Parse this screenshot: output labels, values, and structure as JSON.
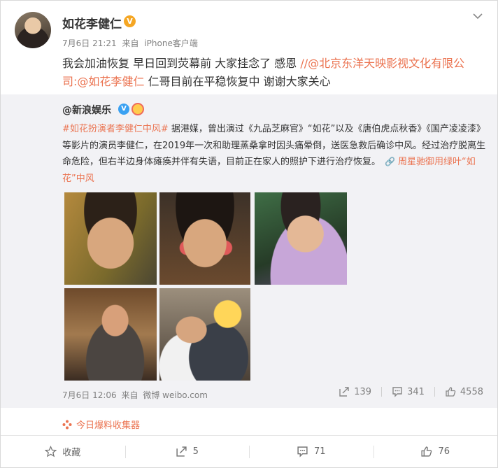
{
  "post": {
    "author": "如花李健仁",
    "verified_badge": "V",
    "date": "7月6日 21:21",
    "source_prefix": "来自",
    "source": "iPhone客户端",
    "text_main": "我会加油恢复 早日回到荧幕前 大家挂念了 感恩 ",
    "text_link1": "//@北京东洋天映影视文化有限公司",
    "text_colon": ":",
    "text_link2": "@如花李健仁",
    "text_tail": " 仁哥目前在平稳恢复中 谢谢大家关心"
  },
  "repost": {
    "author": "@新浪娱乐",
    "hashtag": "#如花扮演者李健仁中风#",
    "body": " 据港媒，曾出演过《九品芝麻官》“如花”以及《唐伯虎点秋香》《国产凌凌漆》等影片的演员李健仁，在2019年一次和助理蒸桑拿时因头痛晕倒，送医急救后确诊中风。经过治疗脱离生命危险，但右半边身体瘫痪并伴有失语，目前正在家人的照护下进行治疗恢复。",
    "video_link": "周星驰御用绿叶“如花”中风",
    "date": "7月6日 12:06",
    "source_prefix": "来自",
    "source": "微博 weibo.com",
    "repost_count": "139",
    "comment_count": "341",
    "like_count": "4558"
  },
  "collector": {
    "label": "今日爆料收集器"
  },
  "actions": {
    "favorite": "收藏",
    "repost": "5",
    "comment": "71",
    "like": "76"
  },
  "colors": {
    "link": "#eb7350",
    "muted": "#808080",
    "repost_bg": "#f2f2f5",
    "badge": "#f5a623"
  }
}
